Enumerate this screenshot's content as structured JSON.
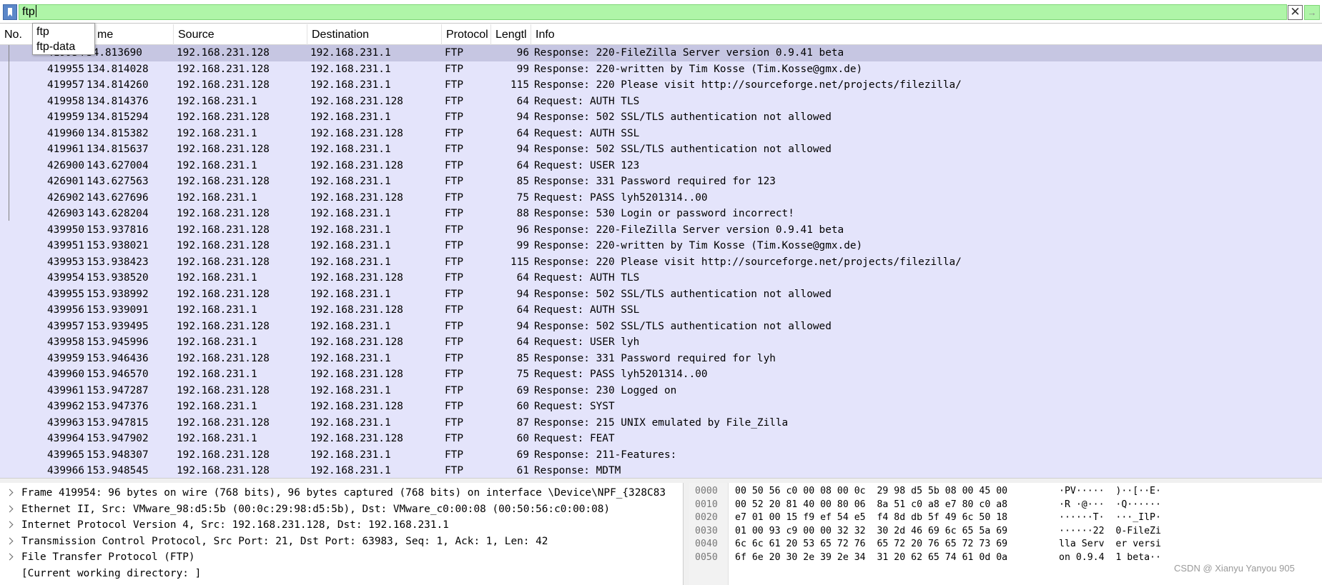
{
  "filter": {
    "value": "ftp",
    "bookmark_icon": "bookmark-icon",
    "clear_icon": "✕",
    "apply_icon": "→",
    "autocomplete": [
      "ftp",
      "ftp-data"
    ]
  },
  "columns": [
    "No.",
    "Time",
    "Source",
    "Destination",
    "Protocol",
    "Length",
    "Info"
  ],
  "columns_visible": [
    "No.",
    "me",
    "Source",
    "Destination",
    "Protocol",
    "Lengtl",
    "Info"
  ],
  "packets": [
    {
      "no": "419954",
      "time": "134.813690",
      "time_visible": "34.813690",
      "src": "192.168.231.128",
      "dst": "192.168.231.1",
      "proto": "FTP",
      "len": "96",
      "info": "Response: 220-FileZilla Server version 0.9.41 beta"
    },
    {
      "no": "419955",
      "time": "134.814028",
      "src": "192.168.231.128",
      "dst": "192.168.231.1",
      "proto": "FTP",
      "len": "99",
      "info": "Response: 220-written by Tim Kosse (Tim.Kosse@gmx.de)"
    },
    {
      "no": "419957",
      "time": "134.814260",
      "src": "192.168.231.128",
      "dst": "192.168.231.1",
      "proto": "FTP",
      "len": "115",
      "info": "Response: 220 Please visit http://sourceforge.net/projects/filezilla/"
    },
    {
      "no": "419958",
      "time": "134.814376",
      "src": "192.168.231.1",
      "dst": "192.168.231.128",
      "proto": "FTP",
      "len": "64",
      "info": "Request: AUTH TLS"
    },
    {
      "no": "419959",
      "time": "134.815294",
      "src": "192.168.231.128",
      "dst": "192.168.231.1",
      "proto": "FTP",
      "len": "94",
      "info": "Response: 502 SSL/TLS authentication not allowed"
    },
    {
      "no": "419960",
      "time": "134.815382",
      "src": "192.168.231.1",
      "dst": "192.168.231.128",
      "proto": "FTP",
      "len": "64",
      "info": "Request: AUTH SSL"
    },
    {
      "no": "419961",
      "time": "134.815637",
      "src": "192.168.231.128",
      "dst": "192.168.231.1",
      "proto": "FTP",
      "len": "94",
      "info": "Response: 502 SSL/TLS authentication not allowed"
    },
    {
      "no": "426900",
      "time": "143.627004",
      "src": "192.168.231.1",
      "dst": "192.168.231.128",
      "proto": "FTP",
      "len": "64",
      "info": "Request: USER 123"
    },
    {
      "no": "426901",
      "time": "143.627563",
      "src": "192.168.231.128",
      "dst": "192.168.231.1",
      "proto": "FTP",
      "len": "85",
      "info": "Response: 331 Password required for 123"
    },
    {
      "no": "426902",
      "time": "143.627696",
      "src": "192.168.231.1",
      "dst": "192.168.231.128",
      "proto": "FTP",
      "len": "75",
      "info": "Request: PASS lyh5201314..00"
    },
    {
      "no": "426903",
      "time": "143.628204",
      "src": "192.168.231.128",
      "dst": "192.168.231.1",
      "proto": "FTP",
      "len": "88",
      "info": "Response: 530 Login or password incorrect!"
    },
    {
      "no": "439950",
      "time": "153.937816",
      "src": "192.168.231.128",
      "dst": "192.168.231.1",
      "proto": "FTP",
      "len": "96",
      "info": "Response: 220-FileZilla Server version 0.9.41 beta"
    },
    {
      "no": "439951",
      "time": "153.938021",
      "src": "192.168.231.128",
      "dst": "192.168.231.1",
      "proto": "FTP",
      "len": "99",
      "info": "Response: 220-written by Tim Kosse (Tim.Kosse@gmx.de)"
    },
    {
      "no": "439953",
      "time": "153.938423",
      "src": "192.168.231.128",
      "dst": "192.168.231.1",
      "proto": "FTP",
      "len": "115",
      "info": "Response: 220 Please visit http://sourceforge.net/projects/filezilla/"
    },
    {
      "no": "439954",
      "time": "153.938520",
      "src": "192.168.231.1",
      "dst": "192.168.231.128",
      "proto": "FTP",
      "len": "64",
      "info": "Request: AUTH TLS"
    },
    {
      "no": "439955",
      "time": "153.938992",
      "src": "192.168.231.128",
      "dst": "192.168.231.1",
      "proto": "FTP",
      "len": "94",
      "info": "Response: 502 SSL/TLS authentication not allowed"
    },
    {
      "no": "439956",
      "time": "153.939091",
      "src": "192.168.231.1",
      "dst": "192.168.231.128",
      "proto": "FTP",
      "len": "64",
      "info": "Request: AUTH SSL"
    },
    {
      "no": "439957",
      "time": "153.939495",
      "src": "192.168.231.128",
      "dst": "192.168.231.1",
      "proto": "FTP",
      "len": "94",
      "info": "Response: 502 SSL/TLS authentication not allowed"
    },
    {
      "no": "439958",
      "time": "153.945996",
      "src": "192.168.231.1",
      "dst": "192.168.231.128",
      "proto": "FTP",
      "len": "64",
      "info": "Request: USER lyh"
    },
    {
      "no": "439959",
      "time": "153.946436",
      "src": "192.168.231.128",
      "dst": "192.168.231.1",
      "proto": "FTP",
      "len": "85",
      "info": "Response: 331 Password required for lyh"
    },
    {
      "no": "439960",
      "time": "153.946570",
      "src": "192.168.231.1",
      "dst": "192.168.231.128",
      "proto": "FTP",
      "len": "75",
      "info": "Request: PASS lyh5201314..00"
    },
    {
      "no": "439961",
      "time": "153.947287",
      "src": "192.168.231.128",
      "dst": "192.168.231.1",
      "proto": "FTP",
      "len": "69",
      "info": "Response: 230 Logged on"
    },
    {
      "no": "439962",
      "time": "153.947376",
      "src": "192.168.231.1",
      "dst": "192.168.231.128",
      "proto": "FTP",
      "len": "60",
      "info": "Request: SYST"
    },
    {
      "no": "439963",
      "time": "153.947815",
      "src": "192.168.231.128",
      "dst": "192.168.231.1",
      "proto": "FTP",
      "len": "87",
      "info": "Response: 215 UNIX emulated by File_Zilla"
    },
    {
      "no": "439964",
      "time": "153.947902",
      "src": "192.168.231.1",
      "dst": "192.168.231.128",
      "proto": "FTP",
      "len": "60",
      "info": "Request: FEAT"
    },
    {
      "no": "439965",
      "time": "153.948307",
      "src": "192.168.231.128",
      "dst": "192.168.231.1",
      "proto": "FTP",
      "len": "69",
      "info": "Response: 211-Features:"
    },
    {
      "no": "439966",
      "time": "153.948545",
      "src": "192.168.231.128",
      "dst": "192.168.231.1",
      "proto": "FTP",
      "len": "61",
      "info": "Response:  MDTM"
    }
  ],
  "details": [
    {
      "text": "Frame 419954: 96 bytes on wire (768 bits), 96 bytes captured (768 bits) on interface \\Device\\NPF_{328C83",
      "expandable": true
    },
    {
      "text": "Ethernet II, Src: VMware_98:d5:5b (00:0c:29:98:d5:5b), Dst: VMware_c0:00:08 (00:50:56:c0:00:08)",
      "expandable": true
    },
    {
      "text": "Internet Protocol Version 4, Src: 192.168.231.128, Dst: 192.168.231.1",
      "expandable": true
    },
    {
      "text": "Transmission Control Protocol, Src Port: 21, Dst Port: 63983, Seq: 1, Ack: 1, Len: 42",
      "expandable": true
    },
    {
      "text": "File Transfer Protocol (FTP)",
      "expandable": true
    },
    {
      "text": "[Current working directory: ]",
      "expandable": false
    }
  ],
  "bytes": [
    {
      "offset": "0000",
      "hex": "00 50 56 c0 00 08 00 0c  29 98 d5 5b 08 00 45 00",
      "ascii": "·PV·····  )··[··E·"
    },
    {
      "offset": "0010",
      "hex": "00 52 20 81 40 00 80 06  8a 51 c0 a8 e7 80 c0 a8",
      "ascii": "·R ·@···  ·Q······"
    },
    {
      "offset": "0020",
      "hex": "e7 01 00 15 f9 ef 54 e5  f4 8d db 5f 49 6c 50 18",
      "ascii": "······T·  ···_IlP·"
    },
    {
      "offset": "0030",
      "hex": "01 00 93 c9 00 00 32 32  30 2d 46 69 6c 65 5a 69",
      "ascii": "······22  0-FileZi"
    },
    {
      "offset": "0040",
      "hex": "6c 6c 61 20 53 65 72 76  65 72 20 76 65 72 73 69",
      "ascii": "lla Serv  er versi"
    },
    {
      "offset": "0050",
      "hex": "6f 6e 20 30 2e 39 2e 34  31 20 62 65 74 61 0d 0a",
      "ascii": "on 0.9.4  1 beta··"
    }
  ],
  "watermark": "CSDN @ Xianyu Yanyou 905"
}
